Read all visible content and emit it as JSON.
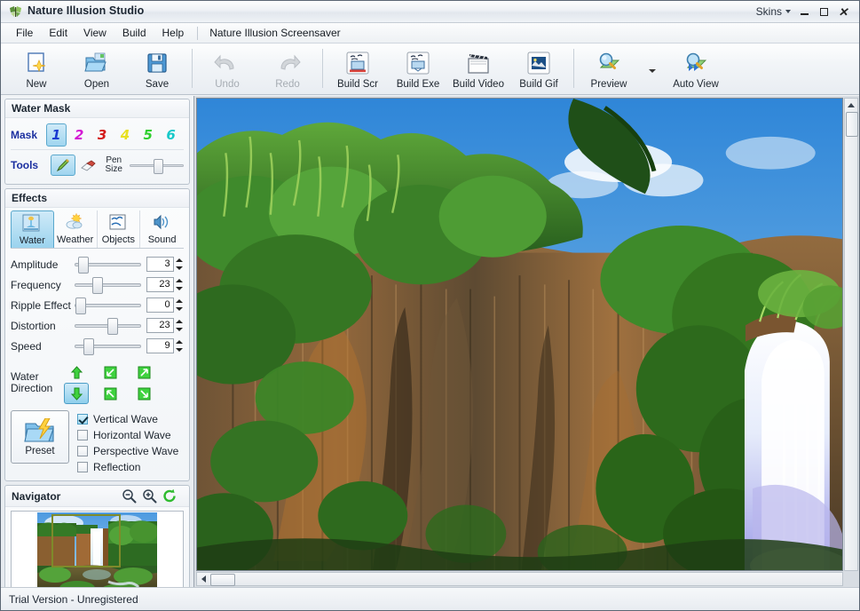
{
  "window": {
    "title": "Nature Illusion Studio",
    "icon": "app-butterfly-icon",
    "skins_label": "Skins",
    "minimize": "minimize-icon",
    "maximize": "maximize-icon",
    "close": "close-icon"
  },
  "menubar": {
    "items": [
      "File",
      "Edit",
      "View",
      "Build",
      "Help"
    ],
    "app_mode": "Nature Illusion Screensaver"
  },
  "toolbar": {
    "buttons": [
      {
        "label": "New",
        "icon": "new-document-icon",
        "enabled": true
      },
      {
        "label": "Open",
        "icon": "open-folder-icon",
        "enabled": true
      },
      {
        "label": "Save",
        "icon": "floppy-save-icon",
        "enabled": true
      },
      {
        "label": "Undo",
        "icon": "undo-arrow-icon",
        "enabled": false
      },
      {
        "label": "Redo",
        "icon": "redo-arrow-icon",
        "enabled": false
      },
      {
        "label": "Build Scr",
        "icon": "build-scr-icon",
        "enabled": true
      },
      {
        "label": "Build Exe",
        "icon": "build-exe-icon",
        "enabled": true
      },
      {
        "label": "Build Video",
        "icon": "build-video-icon",
        "enabled": true
      },
      {
        "label": "Build Gif",
        "icon": "build-gif-icon",
        "enabled": true
      },
      {
        "label": "Preview",
        "icon": "preview-magnifier-icon",
        "enabled": true
      },
      {
        "label": "Auto View",
        "icon": "auto-view-icon",
        "enabled": true
      }
    ]
  },
  "water_mask": {
    "title": "Water Mask",
    "mask_label": "Mask",
    "masks": [
      {
        "number": "1",
        "color": "#1a3ad0",
        "selected": true
      },
      {
        "number": "2",
        "color": "#d41ad4",
        "selected": false
      },
      {
        "number": "3",
        "color": "#d41a1a",
        "selected": false
      },
      {
        "number": "4",
        "color": "#e8e020",
        "selected": false
      },
      {
        "number": "5",
        "color": "#2fcf2f",
        "selected": false
      },
      {
        "number": "6",
        "color": "#18c9c9",
        "selected": false
      }
    ],
    "tools_label": "Tools",
    "pen_tool": "pen-tool-icon",
    "eraser_tool": "eraser-tool-icon",
    "pen_size_label": "Pen\nSize",
    "pen_size_line1": "Pen",
    "pen_size_line2": "Size",
    "pen_size_value": 50
  },
  "effects": {
    "title": "Effects",
    "tabs": [
      {
        "label": "Water",
        "icon": "water-fountain-icon",
        "selected": true
      },
      {
        "label": "Weather",
        "icon": "sun-cloud-icon",
        "selected": false
      },
      {
        "label": "Objects",
        "icon": "objects-birds-icon",
        "selected": false
      },
      {
        "label": "Sound",
        "icon": "speaker-icon",
        "selected": false
      }
    ],
    "sliders": [
      {
        "label": "Amplitude",
        "value": "3",
        "percent": 6
      },
      {
        "label": "Frequency",
        "value": "23",
        "percent": 26
      },
      {
        "label": "Ripple Effect",
        "value": "0",
        "percent": 2
      },
      {
        "label": "Distortion",
        "value": "23",
        "percent": 48
      },
      {
        "label": "Speed",
        "value": "9",
        "percent": 13
      }
    ],
    "direction": {
      "label_line1": "Water",
      "label_line2": "Direction",
      "buttons": [
        {
          "icon": "arrow-up-icon",
          "selected": false
        },
        {
          "icon": "arrow-up-left-icon",
          "selected": false
        },
        {
          "icon": "arrow-up-right-icon",
          "selected": false
        },
        {
          "icon": "arrow-down-icon",
          "selected": true
        },
        {
          "icon": "arrow-down-left-icon",
          "selected": false
        },
        {
          "icon": "arrow-down-right-icon",
          "selected": false
        }
      ]
    },
    "preset": {
      "label": "Preset",
      "icon": "preset-folder-lightning-icon"
    },
    "checkboxes": [
      {
        "label": "Vertical Wave",
        "checked": true
      },
      {
        "label": "Horizontal Wave",
        "checked": false
      },
      {
        "label": "Perspective Wave",
        "checked": false
      },
      {
        "label": "Reflection",
        "checked": false
      }
    ]
  },
  "navigator": {
    "title": "Navigator",
    "zoom_out": "zoom-out-icon",
    "zoom_in": "zoom-in-icon",
    "reset": "refresh-reset-icon",
    "thumbnail_alt": "waterfall-scene-thumbnail",
    "selection_rect": "viewport-selection-rectangle"
  },
  "canvas": {
    "image_alt": "waterfall-cliff-photo",
    "vscroll": "vertical-scrollbar",
    "hscroll": "horizontal-scrollbar"
  },
  "statusbar": {
    "text": "Trial Version - Unregistered"
  },
  "colors": {
    "accent_selected": "#9fd5ef",
    "accent_border": "#5aa8cd",
    "mask_label": "#1b2fa0",
    "nav_selection": "#7e8a2a"
  }
}
